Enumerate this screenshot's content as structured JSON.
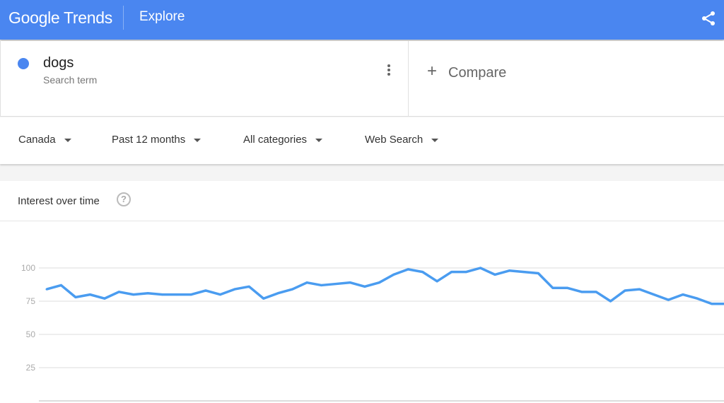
{
  "header": {
    "logo": "Google Trends",
    "section": "Explore",
    "share_icon": "share-icon",
    "color": "#4a86f0"
  },
  "term": {
    "name": "dogs",
    "subtitle": "Search term",
    "color": "#4a86f0"
  },
  "compare": {
    "plus": "+",
    "label": "Compare"
  },
  "filters": [
    {
      "label": "Canada"
    },
    {
      "label": "Past 12 months"
    },
    {
      "label": "All categories"
    },
    {
      "label": "Web Search"
    }
  ],
  "card": {
    "title": "Interest over time",
    "help": "?"
  },
  "chart_data": {
    "type": "line",
    "title": "",
    "xlabel": "",
    "ylabel": "",
    "ylim": [
      0,
      100
    ],
    "yticks": [
      25,
      50,
      75,
      100
    ],
    "grid": true,
    "series": [
      {
        "color": "#4a9cf0",
        "values": [
          84,
          87,
          78,
          80,
          77,
          82,
          80,
          81,
          80,
          80,
          80,
          83,
          80,
          84,
          86,
          77,
          81,
          84,
          89,
          87,
          88,
          89,
          86,
          89,
          95,
          99,
          97,
          90,
          97,
          97,
          100,
          95,
          98,
          97,
          96,
          85,
          85,
          82,
          82,
          75,
          83,
          84,
          80,
          76,
          80,
          77,
          73,
          73
        ]
      }
    ]
  }
}
